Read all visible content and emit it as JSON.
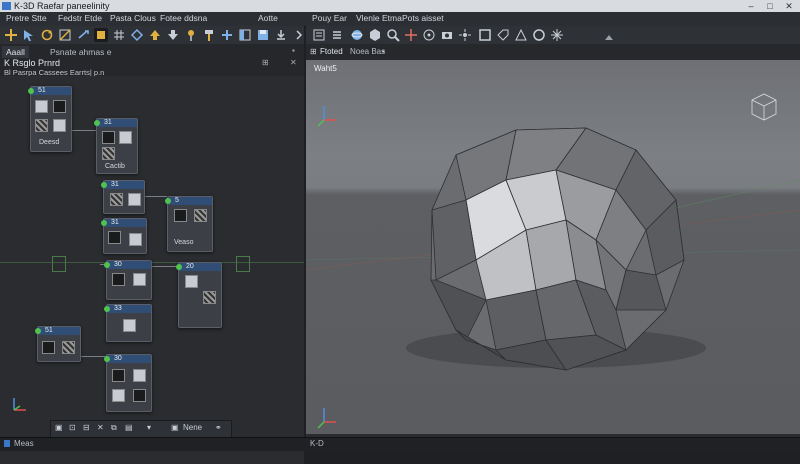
{
  "app": {
    "title": "K-3D Raefar paneelinity"
  },
  "menus": [
    "Pretre Stte",
    "Fedstr Etde",
    "Pasta Clous",
    "Fotee ddsna",
    "Aotte"
  ],
  "viewport_menus": [
    "Pouy Ear",
    "Vlenle Etma",
    "Pots aisset"
  ],
  "left_panel": {
    "tabs": [
      "Aaall",
      "Psnate ahmas e"
    ],
    "title": "K Rsglo Prnrd",
    "subtitle": "Bl Pasrpa Cassees Earrts| p.n"
  },
  "viewport": {
    "tabs": [
      "Ftoted",
      "Noea Bas"
    ],
    "label": "Waht5"
  },
  "nodes": [
    {
      "id": "n1",
      "header": "51",
      "label": "Deesd"
    },
    {
      "id": "n2",
      "header": "31",
      "label": "Cactib"
    },
    {
      "id": "n3",
      "header": "31",
      "label": ""
    },
    {
      "id": "n4",
      "header": "31",
      "label": ""
    },
    {
      "id": "n5",
      "header": "5",
      "label": "Veaso"
    },
    {
      "id": "n6",
      "header": "30",
      "label": ""
    },
    {
      "id": "n7",
      "header": "20",
      "label": ""
    },
    {
      "id": "n8",
      "header": "33",
      "label": ""
    },
    {
      "id": "n9",
      "header": "51",
      "label": ""
    },
    {
      "id": "n10",
      "header": "30",
      "label": ""
    }
  ],
  "bottom_toolbar": {
    "label": "Nene"
  },
  "statusbar": {
    "left": "Meas",
    "right": "K-D"
  },
  "colors": {
    "accent": "#304e75",
    "port": "#4fc24f",
    "background": "#25272b"
  }
}
